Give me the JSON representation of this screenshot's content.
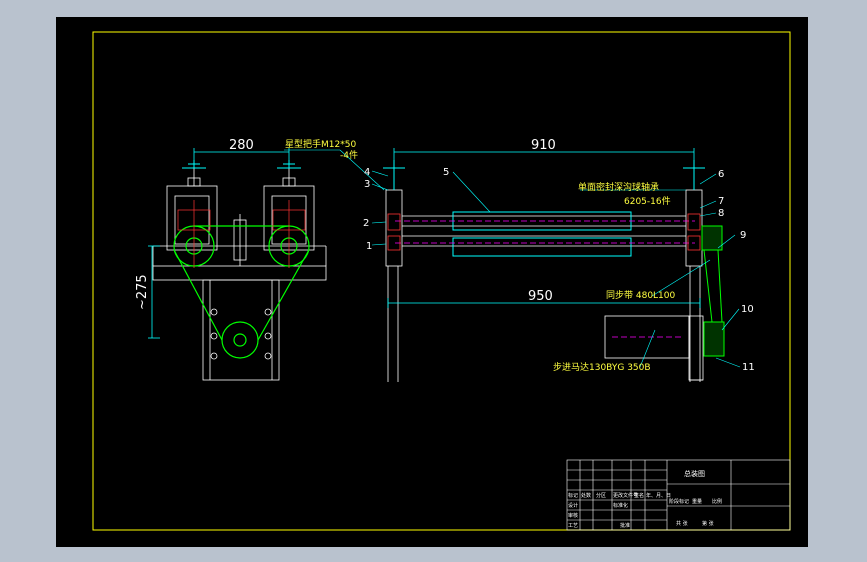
{
  "drawing": {
    "dimensions": {
      "left_width": "280",
      "top_length": "910",
      "bottom_length": "950",
      "left_height": "~275"
    },
    "notes": {
      "handle": "星型把手M12*50",
      "handle_qty": "-4件",
      "bearing": "单面密封深沟球轴承",
      "bearing_spec": "6205-16件",
      "belt": "同步带 480L100",
      "motor": "步进马达130BYG 350B"
    },
    "balloons": [
      "1",
      "2",
      "3",
      "4",
      "5",
      "6",
      "7",
      "8",
      "9",
      "10",
      "11"
    ],
    "title_block": {
      "title": "总装图",
      "cells": [
        "标记",
        "处数",
        "分区",
        "更改文件号",
        "签名",
        "年、月、日",
        "设计",
        "标准化",
        "阶段标记",
        "重量",
        "比例",
        "审核",
        "工艺",
        "批准",
        "共 张",
        "第 张"
      ]
    },
    "colors": {
      "background": "#b9c2ce",
      "sheet": "#000000",
      "frame": "#ffff00",
      "line": "#ffffff",
      "dimension": "#00ffff",
      "hidden": "#ff00ff",
      "part": "#00ff00",
      "center": "#ff3333"
    }
  }
}
